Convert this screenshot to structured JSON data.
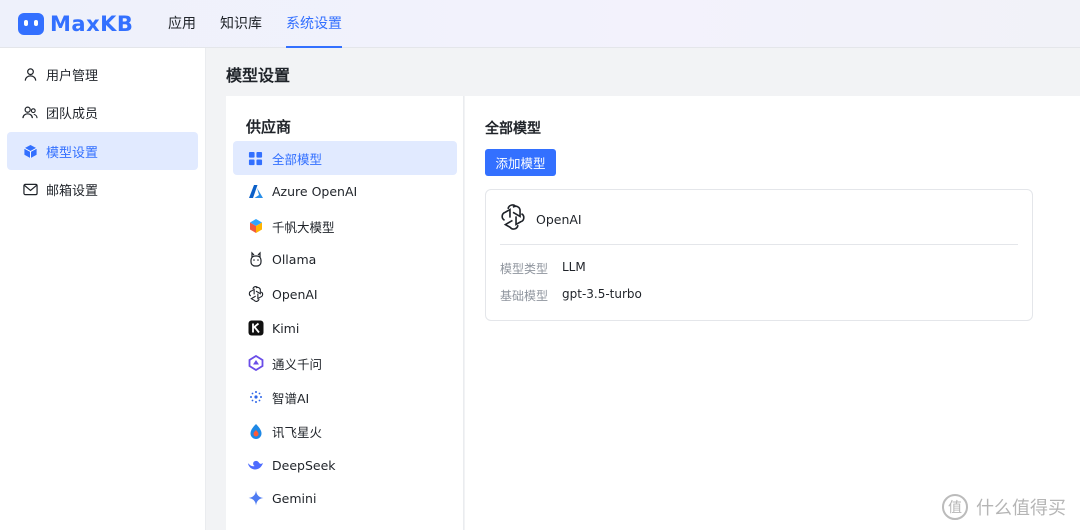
{
  "app": {
    "logo_text": "MaxKB",
    "nav": [
      "应用",
      "知识库",
      "系统设置"
    ],
    "active_nav": "系统设置"
  },
  "sidebar": {
    "items": [
      {
        "label": "用户管理",
        "icon": "user-icon"
      },
      {
        "label": "团队成员",
        "icon": "team-icon"
      },
      {
        "label": "模型设置",
        "icon": "cube-icon",
        "active": true
      },
      {
        "label": "邮箱设置",
        "icon": "mail-icon"
      }
    ]
  },
  "page": {
    "title": "模型设置"
  },
  "providers": {
    "title": "供应商",
    "items": [
      {
        "label": "全部模型",
        "icon": "grid-icon",
        "active": true
      },
      {
        "label": "Azure OpenAI",
        "icon": "azure-icon"
      },
      {
        "label": "千帆大模型",
        "icon": "qianfan-icon"
      },
      {
        "label": "Ollama",
        "icon": "ollama-icon"
      },
      {
        "label": "OpenAI",
        "icon": "openai-icon"
      },
      {
        "label": "Kimi",
        "icon": "kimi-icon"
      },
      {
        "label": "通义千问",
        "icon": "tongyi-icon"
      },
      {
        "label": "智谱AI",
        "icon": "zhipu-icon"
      },
      {
        "label": "讯飞星火",
        "icon": "xunfei-icon"
      },
      {
        "label": "DeepSeek",
        "icon": "deepseek-icon"
      },
      {
        "label": "Gemini",
        "icon": "gemini-icon"
      }
    ]
  },
  "models": {
    "title": "全部模型",
    "add_button": "添加模型",
    "cards": [
      {
        "name": "OpenAI",
        "icon": "openai-icon",
        "type_label": "模型类型",
        "type_value": "LLM",
        "base_label": "基础模型",
        "base_value": "gpt-3.5-turbo"
      }
    ]
  },
  "watermark": {
    "icon_char": "值",
    "text": "什么值得买"
  },
  "colors": {
    "accent": "#3370ff",
    "active_bg": "#e1eaff"
  }
}
